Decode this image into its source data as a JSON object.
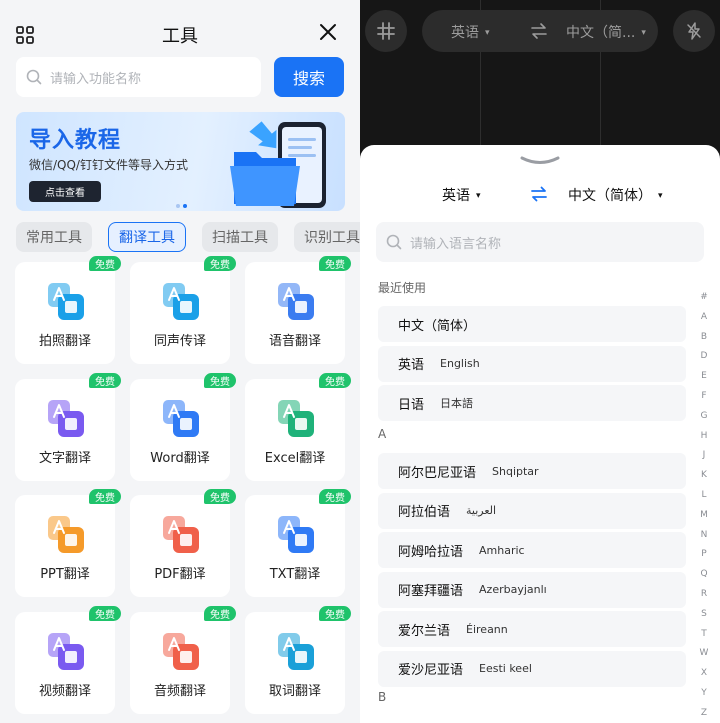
{
  "left": {
    "title": "工具",
    "search_placeholder": "请输入功能名称",
    "search_button": "搜索",
    "banner": {
      "title": "导入教程",
      "subtitle": "微信/QQ/钉钉文件等导入方式",
      "button": "点击查看"
    },
    "tabs": [
      "常用工具",
      "翻译工具",
      "扫描工具",
      "识别工具"
    ],
    "active_tab": "翻译工具",
    "free_badge": "免费",
    "tools": [
      {
        "label": "拍照翻译",
        "icon": "camera-translate-icon",
        "color": "#1aa0e8"
      },
      {
        "label": "同声传译",
        "icon": "simultaneous-interpret-icon",
        "color": "#1aa0e8"
      },
      {
        "label": "语音翻译",
        "icon": "voice-translate-icon",
        "color": "#3b7cf0"
      },
      {
        "label": "文字翻译",
        "icon": "text-translate-icon",
        "color": "#7a5af0"
      },
      {
        "label": "Word翻译",
        "icon": "word-translate-icon",
        "color": "#2f7af5"
      },
      {
        "label": "Excel翻译",
        "icon": "excel-translate-icon",
        "color": "#1fb27a"
      },
      {
        "label": "PPT翻译",
        "icon": "ppt-translate-icon",
        "color": "#f59a2a"
      },
      {
        "label": "PDF翻译",
        "icon": "pdf-translate-icon",
        "color": "#f0604a"
      },
      {
        "label": "TXT翻译",
        "icon": "txt-translate-icon",
        "color": "#2f7af5"
      },
      {
        "label": "视频翻译",
        "icon": "video-translate-icon",
        "color": "#7a5af0"
      },
      {
        "label": "音频翻译",
        "icon": "audio-translate-icon",
        "color": "#f0604a"
      },
      {
        "label": "取词翻译",
        "icon": "word-pick-translate-icon",
        "color": "#1aa0d8"
      }
    ]
  },
  "right": {
    "topbar": {
      "from": "英语",
      "to": "中文（简...",
      "caret": "▾"
    },
    "sheet": {
      "from": "英语",
      "to": "中文（简体）",
      "search_placeholder": "请输入语言名称",
      "recent_label": "最近使用",
      "recent": [
        {
          "cn": "中文（简体）",
          "en": ""
        },
        {
          "cn": "英语",
          "en": "English"
        },
        {
          "cn": "日语",
          "en": "日本語"
        }
      ],
      "section_a": "A",
      "a_items": [
        {
          "cn": "阿尔巴尼亚语",
          "en": "Shqiptar"
        },
        {
          "cn": "阿拉伯语",
          "en": "العربية"
        },
        {
          "cn": "阿姆哈拉语",
          "en": "Amharic"
        },
        {
          "cn": "阿塞拜疆语",
          "en": "Azerbayjanlı"
        },
        {
          "cn": "爱尔兰语",
          "en": "Éireann"
        },
        {
          "cn": "爱沙尼亚语",
          "en": "Eesti keel"
        }
      ],
      "section_b": "B",
      "index": [
        "#",
        "A",
        "B",
        "D",
        "E",
        "F",
        "G",
        "H",
        "J",
        "K",
        "L",
        "M",
        "N",
        "P",
        "Q",
        "R",
        "S",
        "T",
        "W",
        "X",
        "Y",
        "Z"
      ]
    }
  },
  "colors": {
    "accent": "#1a73f5",
    "free": "#1fc36b"
  }
}
